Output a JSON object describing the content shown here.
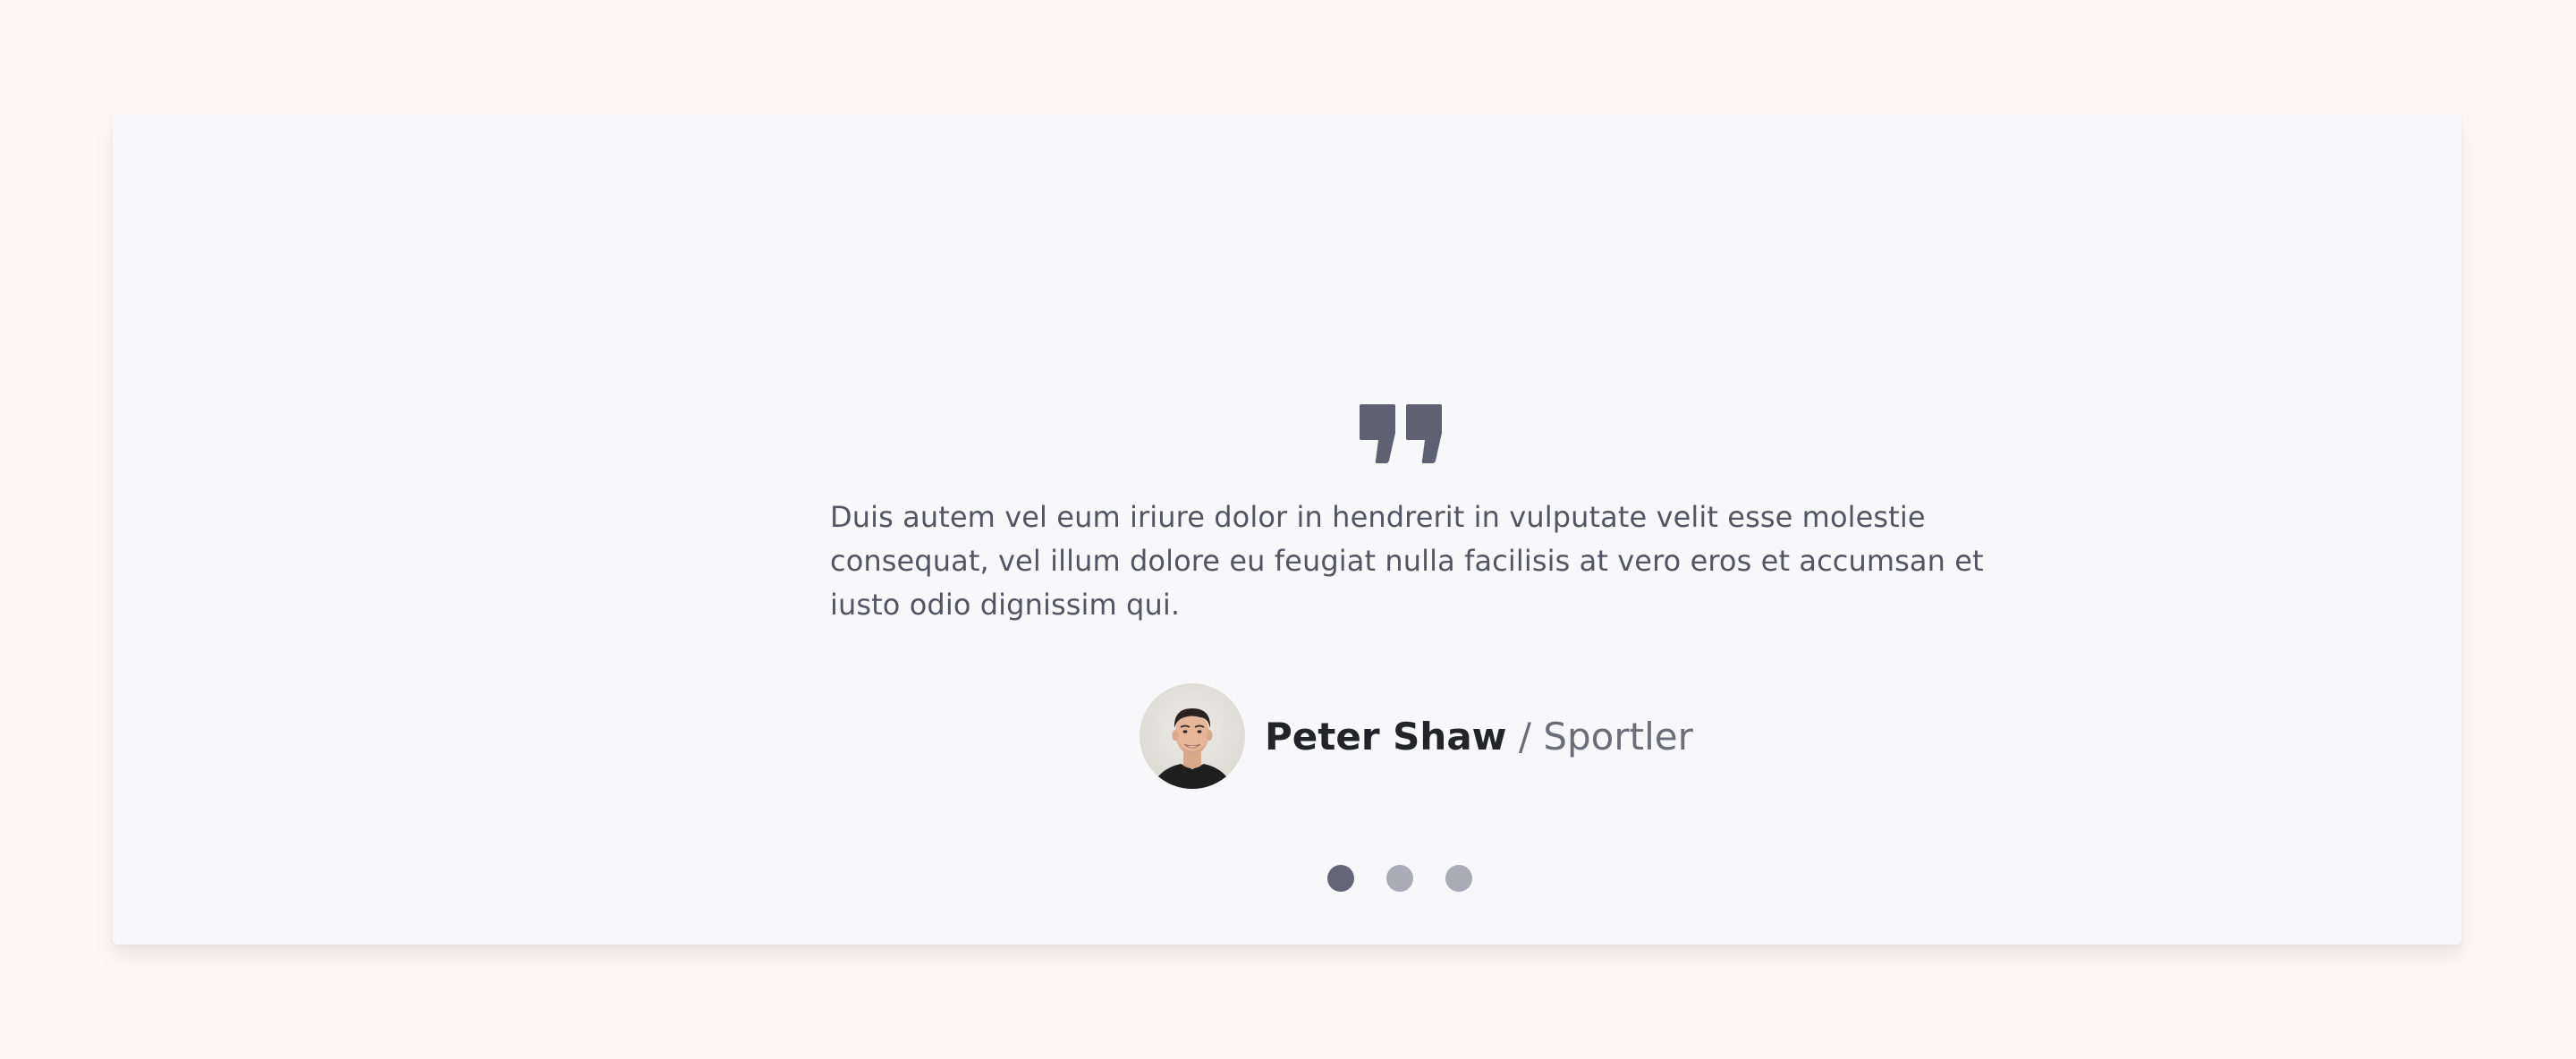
{
  "testimonial": {
    "quote_text": "Duis autem vel eum iriure dolor in hendrerit in vulputate velit esse molestie consequat, vel illum dolore eu feugiat nulla facilisis at vero eros et accumsan et iusto odio dignissim qui.",
    "author_name": "Peter Shaw",
    "separator": "/",
    "author_role": "Sportler",
    "avatar_icon": "person-portrait"
  },
  "carousel": {
    "slide_count": 3,
    "active_index": 0
  },
  "colors": {
    "page_background": "#fff6f1",
    "card_background": "#f8f8fb",
    "quote_icon": "#5f6172",
    "body_text": "#545462",
    "author_name": "#23232a",
    "author_role": "#6d6d78",
    "dot_active": "#646677",
    "dot_inactive": "#ababb7"
  }
}
